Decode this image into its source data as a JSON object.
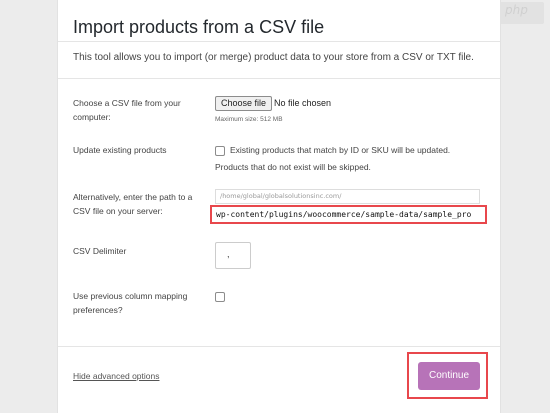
{
  "title": "Import products from a CSV file",
  "intro": "This tool allows you to import (or merge) product data to your store from a CSV or TXT file.",
  "file_row": {
    "label_line1": "Choose a CSV file from your",
    "label_line2": "computer:",
    "button_label": "Choose file",
    "no_file_text": "No file chosen",
    "max_size": "Maximum size: 512 MB"
  },
  "update_row": {
    "label": "Update existing products",
    "checkbox_line1": "Existing products that match by ID or SKU will be updated.",
    "checkbox_line2": "Products that do not exist will be skipped.",
    "checked": false
  },
  "path_row": {
    "label_line1": "Alternatively, enter the path to a",
    "label_line2": "CSV file on your server:",
    "base_path": "/home/global/globalsolutionsinc.com/",
    "value": "wp-content/plugins/woocommerce/sample-data/sample_pro"
  },
  "delimiter_row": {
    "label": "CSV Delimiter",
    "value": ","
  },
  "mapping_row": {
    "label_line1": "Use previous column mapping",
    "label_line2": "preferences?",
    "checked": false
  },
  "footer": {
    "hide_advanced": "Hide advanced options",
    "continue_label": "Continue"
  },
  "watermark": "php",
  "colors": {
    "accent": "#b773b8",
    "highlight": "#e8474c"
  }
}
